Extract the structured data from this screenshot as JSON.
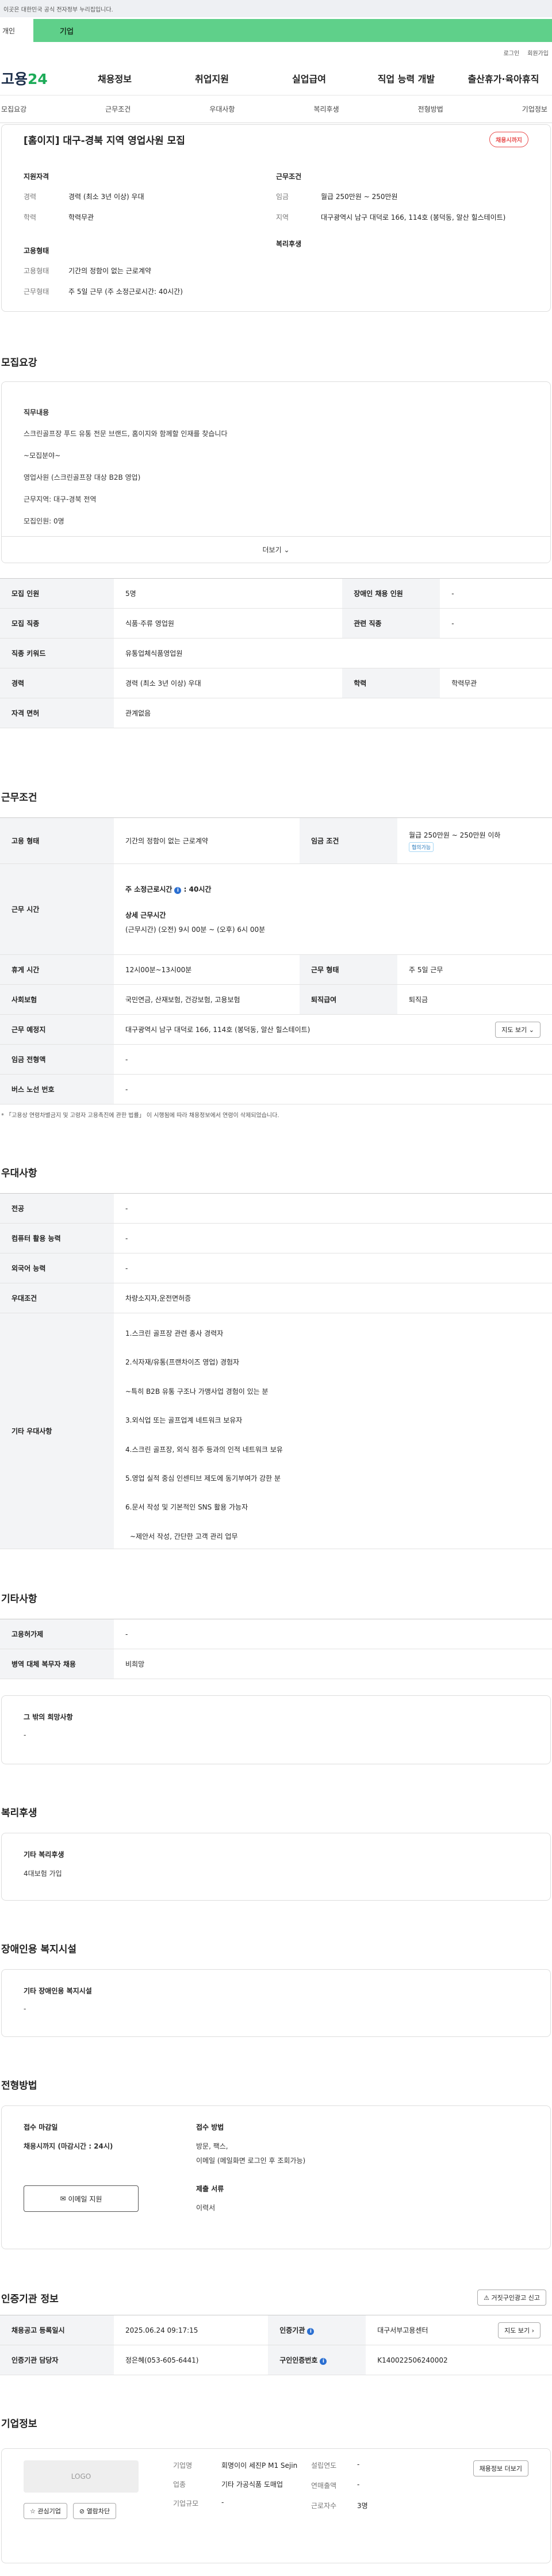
{
  "gov": {
    "notice": "이곳은 대한민국 공식 전자정부 누리집입니다."
  },
  "tabs": {
    "personal": "개인",
    "company": "기업"
  },
  "util": {
    "login": "로그인",
    "join": "회원가입"
  },
  "logo": {
    "prefix": "고용",
    "suffix": "24"
  },
  "gnb": [
    "채용정보",
    "취업지원",
    "실업급여",
    "직업 능력 개발",
    "출산휴가·육아휴직"
  ],
  "subnav": [
    "모집요강",
    "근무조건",
    "우대사항",
    "복리후생",
    "전형방법",
    "기업정보"
  ],
  "hero": {
    "title": "[홈이지] 대구-경북 지역 영업사원 모집",
    "badge": "채용시까지",
    "qual_label": "지원자격",
    "career_k": "경력",
    "career_v": "경력 (최소 3년 이상) 우대",
    "edu_k": "학력",
    "edu_v": "학력무관",
    "emp_label": "고용형태",
    "emptype_k": "고용형태",
    "emptype_v": "기간의 정함이 없는 근로계약",
    "worktype_k": "근무형태",
    "worktype_v": "주 5일 근무 (주 소정근로시간: 40시간)",
    "cond_label": "근무조건",
    "wage_k": "임금",
    "wage_v": "월급 250만원 ~ 250만원",
    "loc_k": "지역",
    "loc_v": "대구광역시 남구 대덕로 166, 114호 (봉덕동, 알산 힐스테이트)",
    "welfare_label": "복리후생"
  },
  "recruit": {
    "heading": "모집요강",
    "desc_title": "직무내용",
    "lines": [
      "스크린골프장 푸드 유통 전문 브랜드, 홈이지와 함께할 인재를 찾습니다",
      "~모집분야~",
      "영업사원 (스크린골프장 대상 B2B 영업)",
      "근무지역: 대구-경북 전역",
      "모집인원: 0명"
    ],
    "more": "더보기",
    "table": [
      [
        "모집 인원",
        "5명",
        "장애인 채용 인원",
        "-"
      ],
      [
        "모집 직종",
        "식품·주류 영업원",
        "관련 직종",
        "-"
      ],
      [
        "직종 키워드",
        "유통업체식품영업원",
        "",
        ""
      ],
      [
        "경력",
        "경력 (최소 3년 이상) 우대",
        "학력",
        "학력무관"
      ],
      [
        "자격 면허",
        "관계없음",
        "",
        ""
      ]
    ]
  },
  "work": {
    "heading": "근무조건",
    "emp_k": "고용 형태",
    "emp_v": "기간의 정함이 없는 근로계약",
    "wage_k": "임금 조건",
    "wage_v": "월급 250만원 ~ 250만원 이하",
    "wage_tag": "협의가능",
    "hours_k": "근무 시간",
    "hours_main": "주 소정근로시간",
    "hours_val": ": 40시간",
    "hours_detail_t": "상세 근무시간",
    "hours_detail_v": "(근무시간) (오전) 9시 00분 ~ (오후) 6시 00분",
    "rest_k": "휴게 시간",
    "rest_v": "12시00분~13시00분",
    "type_k": "근무 형태",
    "type_v": "주 5일 근무",
    "ins_k": "사회보험",
    "ins_v": "국민연금, 산재보험, 건강보험, 고용보험",
    "sev_k": "퇴직급여",
    "sev_v": "퇴직금",
    "place_k": "근무 예정지",
    "place_v": "대구광역시 남구 대덕로 166, 114호 (봉덕동, 알산 힐스테이트)",
    "map_btn": "지도 보기",
    "wagepay_k": "임금 전형액",
    "wagepay_v": "-",
    "bus_k": "버스 노선 번호",
    "bus_v": "-",
    "note": "* 「고용상 연령차별금지 및 고령자 고용촉진에 관한 법률」 이 시행됨에 따라 채용정보에서 연령이 삭제되었습니다."
  },
  "pref": {
    "heading": "우대사항",
    "rows": [
      [
        "전공",
        "-"
      ],
      [
        "컴퓨터 활용 능력",
        "-"
      ],
      [
        "외국어 능력",
        "-"
      ],
      [
        "우대조건",
        "차량소지자,운전면허증"
      ]
    ],
    "etc_k": "기타 우대사항",
    "etc": [
      "1.스크린 골프장 관련 종사 경력자",
      "2.식자재/유통(프랜차이즈 영업) 경험자",
      "~특히 B2B 유통 구조나 가맹사업 경험이 있는 분",
      "3.외식업 또는 골프업계 네트워크 보유자",
      "4.스크린 골프장, 외식 점주 등과의 인적 네트워크 보유",
      "5.영업 실적 중심 인센티브 제도에 동기부여가 강한 분",
      "6.문서 작성 및 기본적인 SNS 활용 가능자",
      "~제안서 작성, 간단한 고객 관리 업무"
    ]
  },
  "etcinfo": {
    "heading": "기타사항",
    "rows": [
      [
        "고용허가제",
        "-"
      ],
      [
        "병역 대체 복무자 채용",
        "비희망"
      ]
    ],
    "box_t": "그 밖의 희망사항",
    "box_v": "-"
  },
  "welfare": {
    "heading": "복리후생",
    "box_t": "기타 복리후생",
    "box_v": "4대보험 가입"
  },
  "disabled": {
    "heading": "장애인용 복지시설",
    "box_t": "기타 장애인용 복지시설",
    "box_v": "-"
  },
  "selection": {
    "heading": "전형방법",
    "deadline_t": "접수 마감일",
    "deadline_v": "채용시까지 (마감시간 : 24시)",
    "apply_btn": "이메일 지원",
    "method_t": "접수 방법",
    "method_v": "방문, 팩스,",
    "method_v2": "이메일 (메일화면 로그인 후 조회가능)",
    "docs_t": "제출 서류",
    "docs_v": "이력서"
  },
  "cert": {
    "heading": "인증기관 정보",
    "report_btn": "거짓구인광고 신고",
    "r1": [
      "채용공고 등록일시",
      "2025.06.24 09:17:15",
      "인증기관",
      "대구서부고용센터"
    ],
    "r2": [
      "인증기관 담당자",
      "정은혜(053-605-6441)",
      "구인인증번호",
      "K140022506240002"
    ],
    "map_btn": "지도 보기"
  },
  "company": {
    "heading": "기업정보",
    "logo": "LOGO",
    "interest_btn": "관심기업",
    "block_btn": "열람차단",
    "name_k": "기업명",
    "name_v": "회명이이 세진P M1 Sejin",
    "ind_k": "업종",
    "ind_v": "기타 가공식품 도매업",
    "scale_k": "기업규모",
    "scale_v": "-",
    "year_k": "설립연도",
    "year_v": "-",
    "sales_k": "연매출액",
    "sales_v": "-",
    "emp_k": "근로자수",
    "emp_v": "3명",
    "jobs_btn": "채용정보 더보기"
  }
}
